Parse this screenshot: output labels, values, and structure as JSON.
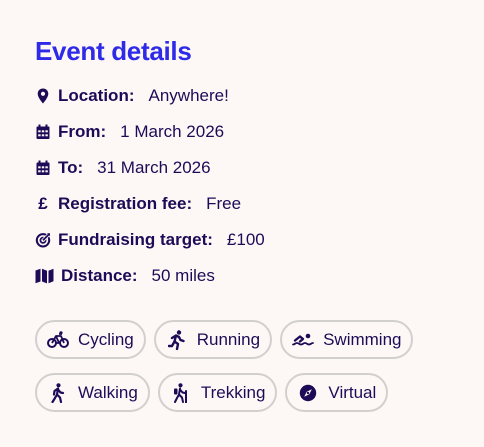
{
  "event": {
    "title": "Event details",
    "details": [
      {
        "icon": "location-pin-icon",
        "label": "Location:",
        "value": "Anywhere!"
      },
      {
        "icon": "calendar-icon",
        "label": "From:",
        "value": "1 March 2026"
      },
      {
        "icon": "calendar-icon",
        "label": "To:",
        "value": "31 March 2026"
      },
      {
        "icon": "pound-sign-icon",
        "glyph": "£",
        "label": "Registration fee:",
        "value": "Free"
      },
      {
        "icon": "target-icon",
        "label": "Fundraising target:",
        "value": "£100"
      },
      {
        "icon": "map-icon",
        "label": "Distance:",
        "value": "50 miles"
      }
    ],
    "tags": [
      {
        "icon": "bicycle-icon",
        "label": "Cycling"
      },
      {
        "icon": "running-icon",
        "label": "Running"
      },
      {
        "icon": "swimming-icon",
        "label": "Swimming"
      },
      {
        "icon": "walking-icon",
        "label": "Walking"
      },
      {
        "icon": "hiking-icon",
        "label": "Trekking"
      },
      {
        "icon": "compass-icon",
        "label": "Virtual"
      }
    ]
  },
  "colors": {
    "title": "#2e2ae8",
    "text": "#1e0b57",
    "background": "#fdf8f6",
    "tag_border": "#d2cfcf"
  }
}
